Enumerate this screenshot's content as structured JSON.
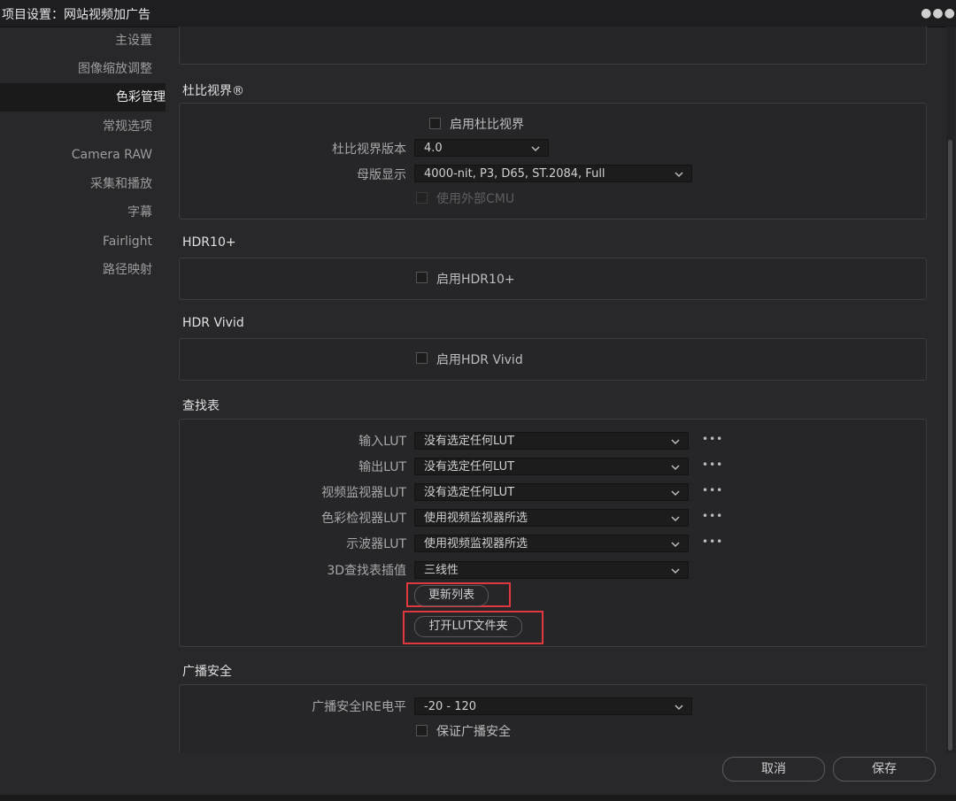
{
  "window": {
    "title": "项目设置：网站视频加广告",
    "more_icon": "more-horizontal-icon"
  },
  "sidebar": {
    "items": [
      {
        "label": "主设置"
      },
      {
        "label": "图像缩放调整"
      },
      {
        "label": "色彩管理",
        "active": true
      },
      {
        "label": "常规选项"
      },
      {
        "label": "Camera RAW"
      },
      {
        "label": "采集和播放"
      },
      {
        "label": "字幕"
      },
      {
        "label": "Fairlight"
      },
      {
        "label": "路径映射"
      }
    ]
  },
  "dolby": {
    "title": "杜比视界®",
    "enable_label": "启用杜比视界",
    "enable_checked": false,
    "version_label": "杜比视界版本",
    "version_value": "4.0",
    "master_label": "母版显示",
    "master_value": "4000-nit, P3, D65, ST.2084, Full",
    "external_cmu_label": "使用外部CMU",
    "external_cmu_checked": false
  },
  "hdr10": {
    "title": "HDR10+",
    "enable_label": "启用HDR10+",
    "enable_checked": false
  },
  "hdrvivid": {
    "title": "HDR Vivid",
    "enable_label": "启用HDR Vivid",
    "enable_checked": false
  },
  "lut": {
    "title": "查找表",
    "rows": [
      {
        "label": "输入LUT",
        "value": "没有选定任何LUT",
        "has_more": true
      },
      {
        "label": "输出LUT",
        "value": "没有选定任何LUT",
        "has_more": true
      },
      {
        "label": "视频监视器LUT",
        "value": "没有选定任何LUT",
        "has_more": true
      },
      {
        "label": "色彩检视器LUT",
        "value": "使用视频监视器所选",
        "has_more": true
      },
      {
        "label": "示波器LUT",
        "value": "使用视频监视器所选",
        "has_more": true
      },
      {
        "label": "3D查找表插值",
        "value": "三线性",
        "has_more": false
      }
    ],
    "more_label": "•••",
    "update_list_label": "更新列表",
    "open_folder_label": "打开LUT文件夹"
  },
  "broadcast": {
    "title": "广播安全",
    "ire_label": "广播安全IRE电平",
    "ire_value": "-20 - 120",
    "ensure_label": "保证广播安全",
    "ensure_checked": false
  },
  "footer": {
    "cancel_label": "取消",
    "save_label": "保存"
  },
  "colors": {
    "highlight": "#e0383f",
    "background": "#28282a",
    "panel": "#262628"
  }
}
